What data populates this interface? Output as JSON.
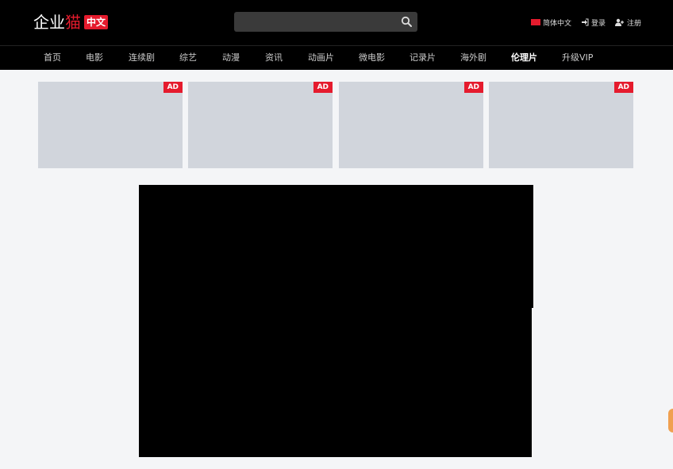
{
  "header": {
    "logo": {
      "text_white": "企业",
      "text_red": "猫",
      "badge": "中文"
    },
    "search": {
      "placeholder": "",
      "button_icon": "search-icon"
    },
    "user_links": {
      "language": "简体中文",
      "login": "登录",
      "register": "注册"
    }
  },
  "nav": {
    "items": [
      {
        "label": "首页"
      },
      {
        "label": "电影"
      },
      {
        "label": "连续剧"
      },
      {
        "label": "综艺"
      },
      {
        "label": "动漫"
      },
      {
        "label": "资讯"
      },
      {
        "label": "动画片"
      },
      {
        "label": "微电影"
      },
      {
        "label": "记录片"
      },
      {
        "label": "海外剧"
      },
      {
        "label": "伦理片",
        "active": true
      },
      {
        "label": "升级VIP"
      }
    ]
  },
  "ads": [
    {
      "tag": "AD"
    },
    {
      "tag": "AD"
    },
    {
      "tag": "AD"
    },
    {
      "tag": "AD"
    }
  ],
  "colors": {
    "accent": "#e51b2d",
    "header_bg": "#000000",
    "page_bg": "#f4f5f7",
    "ad_placeholder": "#d1d5dc"
  }
}
